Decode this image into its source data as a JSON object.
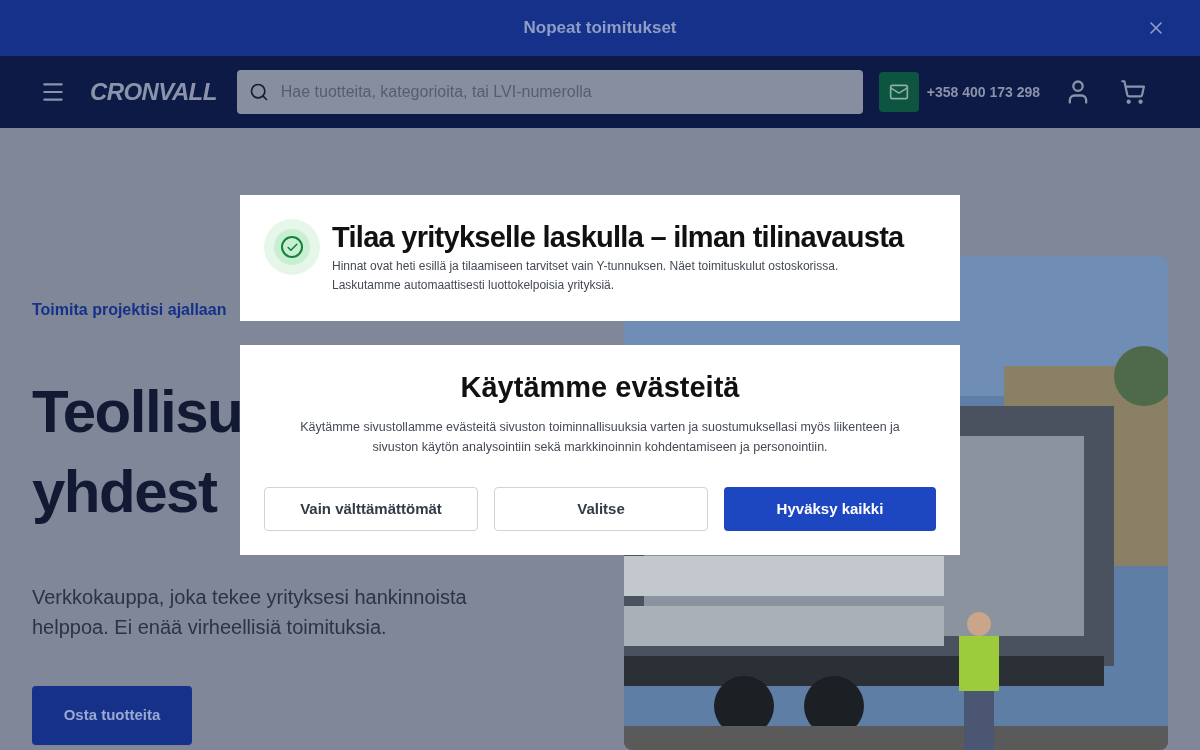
{
  "banner": {
    "text": "Nopeat toimitukset"
  },
  "header": {
    "logo": "CRONVALL",
    "search": {
      "placeholder": "Hae tuotteita, kategorioita, tai LVI-numerolla"
    },
    "phone": "+358 400 173 298"
  },
  "hero": {
    "eyebrow": "Toimita projektisi ajallaan",
    "headline": [
      "Teollisu",
      "yhdest"
    ],
    "lead": "Verkkokauppa, joka tekee yrityksesi hankinnoista helppoa. Ei enää virheellisiä toimituksia.",
    "cta": "Osta tuotteita",
    "image": {
      "kind": "picture"
    }
  },
  "invoice_notice": {
    "title": "Tilaa yritykselle laskulla – ilman tilinavausta",
    "text": "Hinnat ovat heti esillä ja tilaamiseen tarvitset vain Y-tunnuksen. Näet toimituskulut ostoskorissa. Laskutamme automaattisesti luottokelpoisia yrityksiä."
  },
  "cookie_dialog": {
    "title": "Käytämme evästeitä",
    "text": "Käytämme sivustollamme evästeitä sivuston toiminnallisuuksia varten ja suostumuksellasi myös liikenteen ja sivuston käytön analysointiin sekä markkinoinnin kohdentamiseen ja personointiin.",
    "buttons": [
      {
        "label": "Vain välttämättömät",
        "kind": "secondary"
      },
      {
        "label": "Valitse",
        "kind": "secondary"
      },
      {
        "label": "Hyväksy kaikki",
        "kind": "primary"
      }
    ]
  }
}
